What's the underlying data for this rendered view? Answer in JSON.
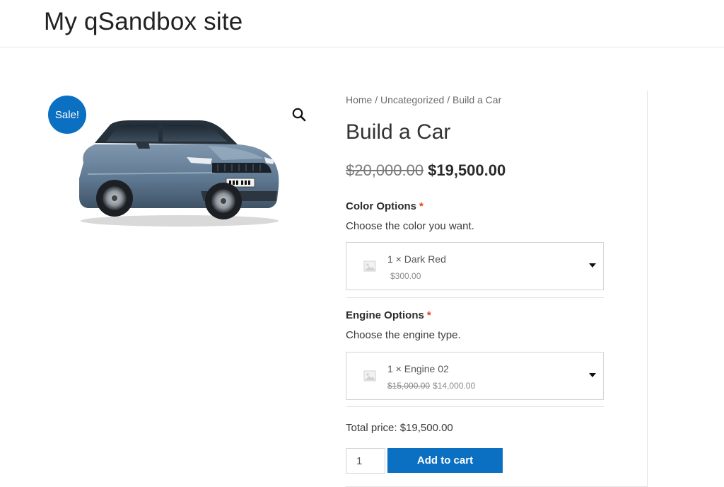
{
  "site": {
    "title": "My qSandbox site"
  },
  "product": {
    "sale_badge": "Sale!",
    "breadcrumb": {
      "home": "Home",
      "sep": " / ",
      "category": "Uncategorized",
      "current": "Build a Car"
    },
    "title": "Build a Car",
    "price_old": "$20,000.00",
    "price_new": "$19,500.00",
    "image_icon": "zoom-magnifier-icon"
  },
  "options": [
    {
      "label": "Color Options",
      "required": "*",
      "description": "Choose the color you want.",
      "selected_name": "1 × Dark Red",
      "selected_price": "$300.00",
      "selected_price_old": ""
    },
    {
      "label": "Engine Options",
      "required": "*",
      "description": "Choose the engine type.",
      "selected_name": "1 × Engine 02",
      "selected_price": "$14,000.00",
      "selected_price_old": "$15,000.00"
    }
  ],
  "cart": {
    "total_label": "Total price: $19,500.00",
    "quantity": "1",
    "add_label": "Add to cart"
  },
  "colors": {
    "accent": "#0b6fc2",
    "required": "#e2401c"
  }
}
